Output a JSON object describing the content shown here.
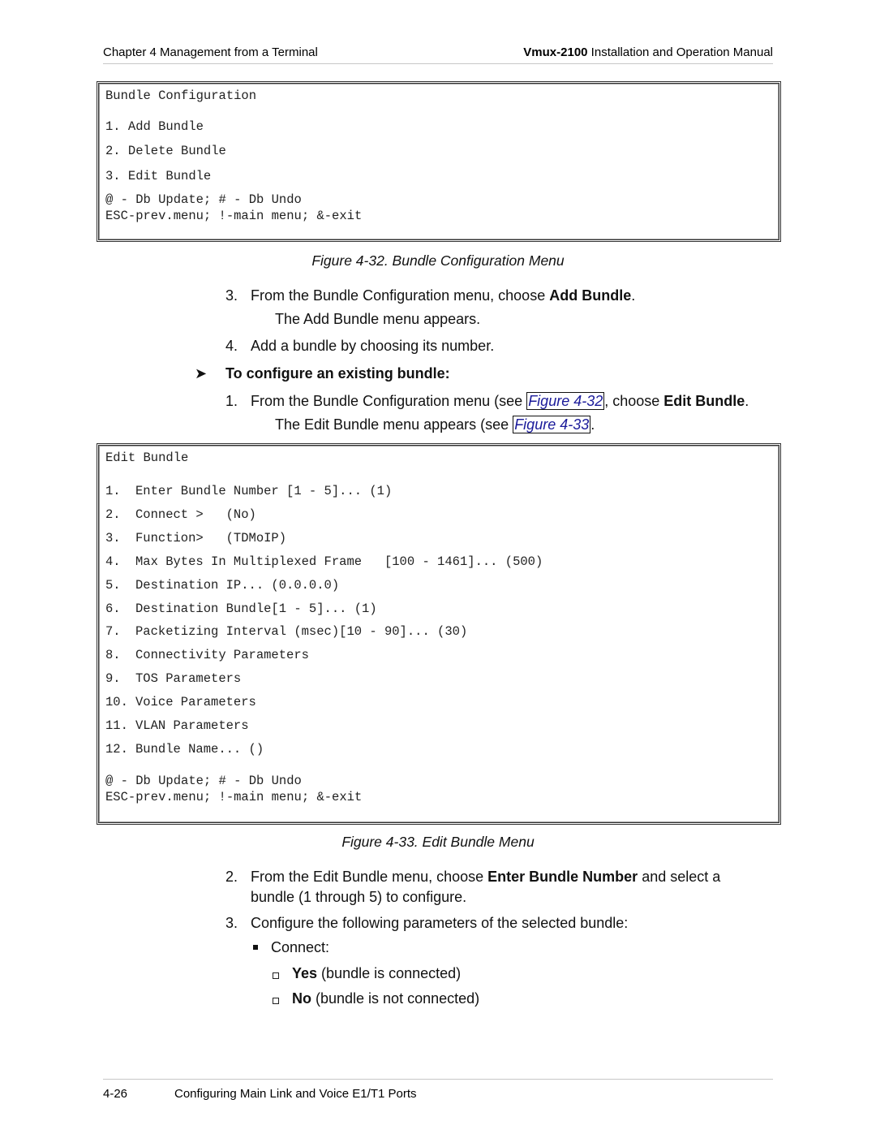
{
  "header": {
    "chapter": "Chapter 4  Management from a Terminal",
    "product": "Vmux-2100",
    "manual": " Installation and Operation Manual"
  },
  "figure32": {
    "terminal": {
      "title": "Bundle Configuration",
      "items": [
        "1. Add Bundle",
        "2. Delete Bundle",
        "3. Edit Bundle"
      ],
      "footer_line1": "@ - Db Update; # - Db Undo",
      "footer_line2": "ESC-prev.menu; !-main menu; &-exit"
    },
    "caption": "Figure 4-32.  Bundle Configuration Menu"
  },
  "steps_a": {
    "step3_num": "3.",
    "step3_pre": "From the Bundle Configuration menu, choose ",
    "step3_bold": "Add Bundle",
    "step3_post": ".",
    "step3_result": "The Add Bundle menu appears.",
    "step4_num": "4.",
    "step4_text": "Add a bundle by choosing its number."
  },
  "procedure": {
    "arrow": "➤",
    "heading": "To configure an existing bundle:",
    "step1_num": "1.",
    "step1_pre": "From the Bundle Configuration menu (see ",
    "step1_link": "Figure 4-32",
    "step1_mid": ", choose ",
    "step1_bold": "Edit Bundle",
    "step1_post": ".",
    "step1_result_pre": "The Edit Bundle menu appears (see ",
    "step1_result_link": "Figure 4-33",
    "step1_result_post": "."
  },
  "figure33": {
    "terminal": {
      "title": "Edit Bundle",
      "items": [
        {
          "num": "1.",
          "text": "Enter Bundle Number [1 - 5]... (1)"
        },
        {
          "num": "2.",
          "text": "Connect >   (No)"
        },
        {
          "num": "3.",
          "text": "Function>   (TDMoIP)"
        },
        {
          "num": "4.",
          "text": "Max Bytes In Multiplexed Frame   [100 - 1461]... (500)"
        },
        {
          "num": "5.",
          "text": "Destination IP... (0.0.0.0)"
        },
        {
          "num": "6.",
          "text": "Destination Bundle[1 - 5]... (1)"
        },
        {
          "num": "7.",
          "text": "Packetizing Interval (msec)[10 - 90]... (30)"
        },
        {
          "num": "8.",
          "text": "Connectivity Parameters"
        },
        {
          "num": "9.",
          "text": "TOS Parameters"
        },
        {
          "num": "10.",
          "text": "Voice Parameters"
        },
        {
          "num": "11.",
          "text": "VLAN Parameters"
        },
        {
          "num": "12.",
          "text": "Bundle Name... ()"
        }
      ],
      "footer_line1": "@ - Db Update; # - Db Undo",
      "footer_line2": "ESC-prev.menu; !-main menu; &-exit"
    },
    "caption": "Figure 4-33.  Edit Bundle Menu"
  },
  "steps_b": {
    "step2_num": "2.",
    "step2_pre": "From the Edit Bundle menu, choose ",
    "step2_bold": "Enter Bundle Number",
    "step2_post": " and select a",
    "step2_line2": "bundle (1 through 5) to configure.",
    "step3_num": "3.",
    "step3_text": "Configure the following parameters of the selected bundle:",
    "bullet_connect": "Connect:",
    "opt_yes_bold": "Yes",
    "opt_yes_text": " (bundle is connected)",
    "opt_no_bold": "No",
    "opt_no_text": " (bundle is not connected)"
  },
  "footer": {
    "page_number": "4-26",
    "section": "Configuring Main Link and Voice E1/T1 Ports"
  }
}
